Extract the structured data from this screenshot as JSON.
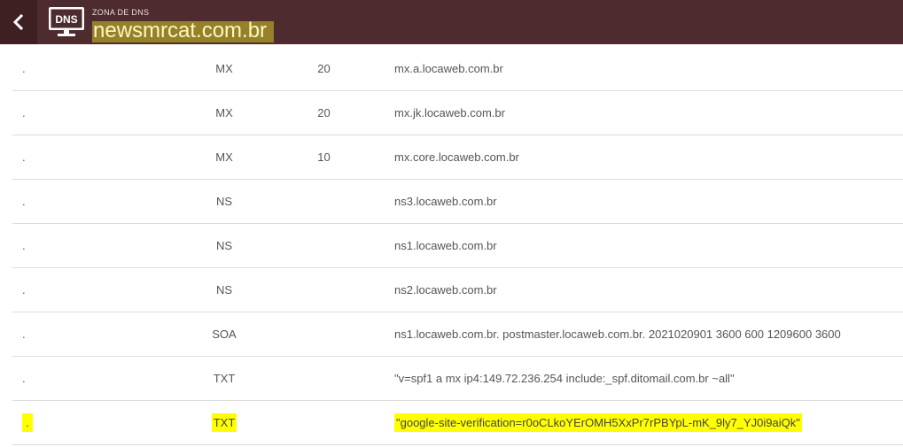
{
  "header": {
    "subtitle": "ZONA DE DNS",
    "title": "newsmrcat.com.br",
    "icon_label": "DNS",
    "bg_color": "#4e2b2e",
    "back_icon": "chevron-left-icon"
  },
  "records": [
    {
      "name": ".",
      "type": "MX",
      "priority": "20",
      "data": "mx.a.locaweb.com.br"
    },
    {
      "name": ".",
      "type": "MX",
      "priority": "20",
      "data": "mx.jk.locaweb.com.br"
    },
    {
      "name": ".",
      "type": "MX",
      "priority": "10",
      "data": "mx.core.locaweb.com.br"
    },
    {
      "name": ".",
      "type": "NS",
      "priority": "",
      "data": "ns3.locaweb.com.br"
    },
    {
      "name": ".",
      "type": "NS",
      "priority": "",
      "data": "ns1.locaweb.com.br"
    },
    {
      "name": ".",
      "type": "NS",
      "priority": "",
      "data": "ns2.locaweb.com.br"
    },
    {
      "name": ".",
      "type": "SOA",
      "priority": "",
      "data": "ns1.locaweb.com.br. postmaster.locaweb.com.br. 2021020901 3600 600 1209600 3600"
    },
    {
      "name": ".",
      "type": "TXT",
      "priority": "",
      "data": "\"v=spf1 a mx ip4:149.72.236.254 include:_spf.ditomail.com.br ~all\""
    },
    {
      "name": ".",
      "type": "TXT",
      "priority": "",
      "data": "\"google-site-verification=r0oCLkoYErOMH5XxPr7rPBYpL-mK_9ly7_YJ0i9aiQk\"",
      "highlighted": true
    }
  ]
}
